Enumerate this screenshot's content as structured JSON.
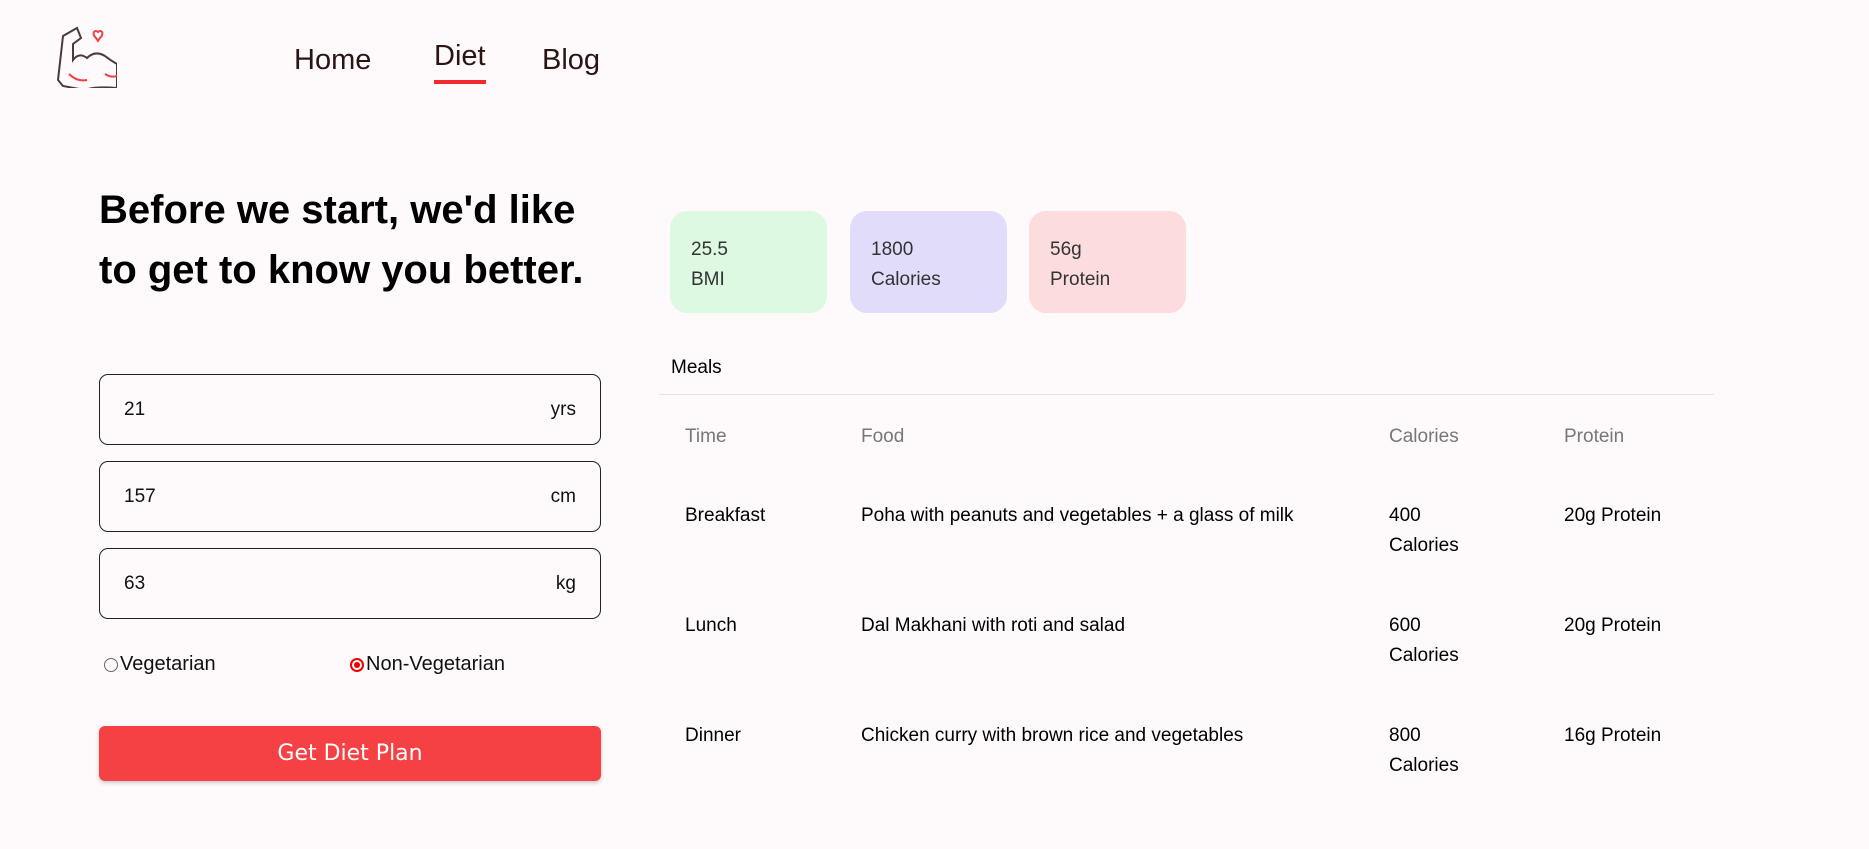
{
  "nav": {
    "items": [
      {
        "label": "Home"
      },
      {
        "label": "Diet",
        "active": true
      },
      {
        "label": "Blog"
      }
    ]
  },
  "form": {
    "heading": "Before we start, we'd like to get to know you better.",
    "age": {
      "value": "21",
      "unit": "yrs"
    },
    "height": {
      "value": "157",
      "unit": "cm"
    },
    "weight": {
      "value": "63",
      "unit": "kg"
    },
    "diet_options": [
      {
        "label": "Vegetarian",
        "selected": false
      },
      {
        "label": "Non-Vegetarian",
        "selected": true
      }
    ],
    "submit_label": "Get Diet Plan"
  },
  "stats": [
    {
      "value": "25.5",
      "label": "BMI",
      "color": "#ddf9e2"
    },
    {
      "value": "1800",
      "label": "Calories",
      "color": "#e2dcfb"
    },
    {
      "value": "56g",
      "label": "Protein",
      "color": "#fddcdd"
    }
  ],
  "meals": {
    "title": "Meals",
    "columns": [
      "Time",
      "Food",
      "Calories",
      "Protein"
    ],
    "rows": [
      {
        "time": "Breakfast",
        "food": "Poha with peanuts and vegetables + a glass of milk",
        "calories": "400 Calories",
        "protein": "20g Protein"
      },
      {
        "time": "Lunch",
        "food": "Dal Makhani with roti and salad",
        "calories": "600 Calories",
        "protein": "20g Protein"
      },
      {
        "time": "Dinner",
        "food": "Chicken curry with brown rice and vegetables",
        "calories": "800 Calories",
        "protein": "16g Protein"
      }
    ]
  }
}
